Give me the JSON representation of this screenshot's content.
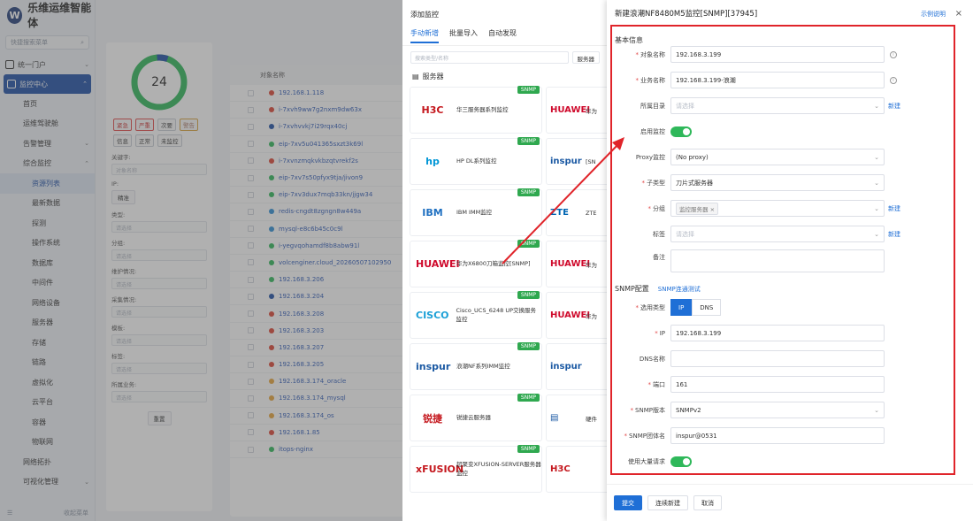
{
  "app": {
    "name": "乐维运维智能体",
    "logo": "W"
  },
  "sidebar": {
    "search_placeholder": "快捷搜索菜单",
    "items": [
      {
        "label": "统一门户",
        "icon": "portal-icon",
        "chevron": "⌄"
      },
      {
        "label": "监控中心",
        "icon": "monitor-icon",
        "chevron": "⌃",
        "active": true
      }
    ],
    "sub_items": [
      "首页",
      "运维驾驶舱",
      "告警管理",
      "综合监控",
      "资源列表",
      "最新数据",
      "探测",
      "操作系统",
      "数据库",
      "中间件",
      "网络设备",
      "服务器",
      "存储",
      "链路",
      "虚拟化",
      "云平台",
      "容器",
      "物联网",
      "网络拓扑",
      "可视化管理"
    ],
    "bottom_label": "收起菜单"
  },
  "filter": {
    "donut_count": "24",
    "tags_row1": [
      "紧急",
      "严重",
      "次要",
      "警告"
    ],
    "tags_row2": [
      "信息",
      "正常",
      "未监控"
    ],
    "fields": [
      "关键字:",
      "IP:",
      "类型:",
      "分组:",
      "维护情况:",
      "采集情况:",
      "模板:",
      "标签:",
      "所属业务:"
    ],
    "keyword_placeholder": "对象名称",
    "precise": "精准",
    "input_placeholder": "请选择",
    "reset": "重置"
  },
  "list": {
    "header": "对象名称",
    "rows": [
      "192.168.1.118",
      "i-7xvh9ww7g2nxm9dw63x",
      "i-7xvhvvkj7i29rqx40cj",
      "eip-7xv5u041365sxzt3k69l",
      "i-7xvnzmqkvkbzqtvrekf2s",
      "eip-7xv7s50pfyx9tja/jivon9",
      "eip-7xv3dux7mqb33kn/jjgw34",
      "redis-cngdt8zgngn8w449a",
      "mysql-e8c6b45c0c9l",
      "i-yegvqohamdf8b8abw91l",
      "volcenginer.cloud_20260507102950",
      "192.168.3.206",
      "192.168.3.204",
      "192.168.3.208",
      "192.168.3.203",
      "192.168.3.207",
      "192.168.3.205",
      "192.168.3.174_oracle",
      "192.168.3.174_mysql",
      "192.168.3.174_os",
      "192.168.1.85",
      "itops-nginx"
    ]
  },
  "add_monitor": {
    "title": "添加监控",
    "tabs": [
      "手动新增",
      "批量导入",
      "自动发现"
    ],
    "search_placeholder": "搜索类型/名称",
    "search_btn": "服务器",
    "section": "服务器",
    "snmp_badge": "SNMP",
    "cards_left": [
      {
        "logo": "H3C",
        "name": "华三服务器系列监控",
        "logo_color": "#c4161c"
      },
      {
        "logo": "hp",
        "name": "HP DL系列监控",
        "logo_color": "#0096d6"
      },
      {
        "logo": "IBM",
        "name": "IBM IMM监控",
        "logo_color": "#1f70c1"
      },
      {
        "logo": "HUAWEI",
        "name": "华为X6800刀箱监控[SNMP]",
        "logo_color": "#cf0a2c"
      },
      {
        "logo": "CISCO",
        "name": "Cisco_UCS_6248 UP交换服务监控",
        "logo_color": "#1ba0d7"
      },
      {
        "logo": "inspur",
        "name": "浪潮NF系列IMM监控",
        "logo_color": "#1b59a3"
      },
      {
        "logo": "锐捷",
        "name": "锐捷云服务器",
        "logo_color": "#c4161c"
      },
      {
        "logo": "xFUSION",
        "name": "超聚变XFUSION-SERVER服务器监控",
        "logo_color": "#c4161c"
      }
    ],
    "cards_right": [
      {
        "logo": "HUAWEI",
        "label": "华为",
        "logo_color": "#cf0a2c"
      },
      {
        "logo": "inspur",
        "label": "[SN",
        "logo_color": "#1b59a3"
      },
      {
        "logo": "ZTE",
        "label": "ZTE",
        "logo_color": "#0066b3"
      },
      {
        "logo": "HUAWEI",
        "label": "华为",
        "logo_color": "#cf0a2c"
      },
      {
        "logo": "HUAWEI",
        "label": "华为",
        "logo_color": "#cf0a2c"
      },
      {
        "logo": "inspur",
        "label": "",
        "logo_color": "#1b59a3"
      },
      {
        "logo": "▤",
        "label": "硬件",
        "logo_color": "#1b59a3"
      },
      {
        "logo": "H3C",
        "label": "",
        "logo_color": "#c4161c"
      }
    ]
  },
  "drawer": {
    "title": "新建浪潮NF8480M5监控[SNMP][37945]",
    "help": "示例说明",
    "close": "×",
    "section_basic": "基本信息",
    "object_name_label": "对象名称",
    "object_name": "192.168.3.199",
    "business_name_label": "业务名称",
    "business_name": "192.168.3.199-浪潮",
    "catalog_label": "所属目录",
    "select_placeholder": "请选择",
    "new_link": "新建",
    "enable_label": "启用监控",
    "proxy_label": "Proxy监控",
    "proxy_value": "(No proxy)",
    "subtype_label": "子类型",
    "subtype_value": "刀片式服务器",
    "group_label": "分组",
    "group_chip": "监控服务器",
    "tag_label": "标签",
    "remark_label": "备注",
    "section_snmp": "SNMP配置",
    "snmp_test": "SNMP连通测试",
    "use_type_label": "选用类型",
    "seg_ip": "IP",
    "seg_dns": "DNS",
    "ip_label": "IP",
    "ip_value": "192.168.3.199",
    "dns_label": "DNS名称",
    "port_label": "端口",
    "port_value": "161",
    "snmp_version_label": "SNMP版本",
    "snmp_version": "SNMPv2",
    "community_label": "SNMP团体名",
    "community": "inspur@0531",
    "bulk_label": "使用大量请求",
    "submit": "提交",
    "continue_new": "连续新建",
    "cancel": "取消"
  },
  "colors": {
    "accent": "#1f6fd6",
    "success": "#2fb85a",
    "highlight": "#e0242a",
    "nav_active": "#1e4fa6"
  }
}
